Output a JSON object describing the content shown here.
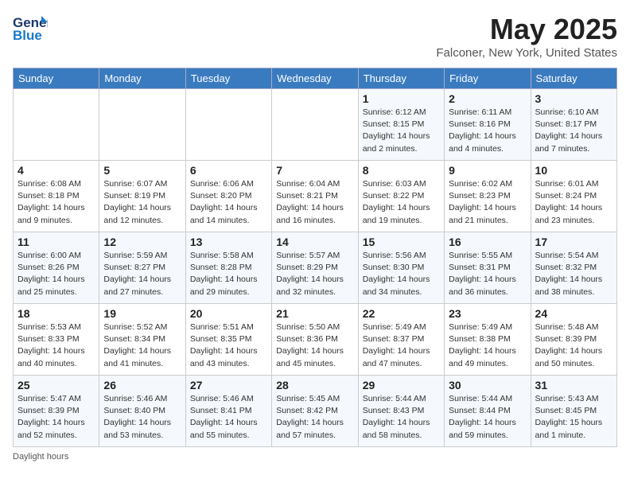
{
  "header": {
    "logo_line1": "General",
    "logo_line2": "Blue",
    "month": "May 2025",
    "location": "Falconer, New York, United States"
  },
  "days_of_week": [
    "Sunday",
    "Monday",
    "Tuesday",
    "Wednesday",
    "Thursday",
    "Friday",
    "Saturday"
  ],
  "weeks": [
    [
      {
        "day": "",
        "info": ""
      },
      {
        "day": "",
        "info": ""
      },
      {
        "day": "",
        "info": ""
      },
      {
        "day": "",
        "info": ""
      },
      {
        "day": "1",
        "info": "Sunrise: 6:12 AM\nSunset: 8:15 PM\nDaylight: 14 hours and 2 minutes."
      },
      {
        "day": "2",
        "info": "Sunrise: 6:11 AM\nSunset: 8:16 PM\nDaylight: 14 hours and 4 minutes."
      },
      {
        "day": "3",
        "info": "Sunrise: 6:10 AM\nSunset: 8:17 PM\nDaylight: 14 hours and 7 minutes."
      }
    ],
    [
      {
        "day": "4",
        "info": "Sunrise: 6:08 AM\nSunset: 8:18 PM\nDaylight: 14 hours and 9 minutes."
      },
      {
        "day": "5",
        "info": "Sunrise: 6:07 AM\nSunset: 8:19 PM\nDaylight: 14 hours and 12 minutes."
      },
      {
        "day": "6",
        "info": "Sunrise: 6:06 AM\nSunset: 8:20 PM\nDaylight: 14 hours and 14 minutes."
      },
      {
        "day": "7",
        "info": "Sunrise: 6:04 AM\nSunset: 8:21 PM\nDaylight: 14 hours and 16 minutes."
      },
      {
        "day": "8",
        "info": "Sunrise: 6:03 AM\nSunset: 8:22 PM\nDaylight: 14 hours and 19 minutes."
      },
      {
        "day": "9",
        "info": "Sunrise: 6:02 AM\nSunset: 8:23 PM\nDaylight: 14 hours and 21 minutes."
      },
      {
        "day": "10",
        "info": "Sunrise: 6:01 AM\nSunset: 8:24 PM\nDaylight: 14 hours and 23 minutes."
      }
    ],
    [
      {
        "day": "11",
        "info": "Sunrise: 6:00 AM\nSunset: 8:26 PM\nDaylight: 14 hours and 25 minutes."
      },
      {
        "day": "12",
        "info": "Sunrise: 5:59 AM\nSunset: 8:27 PM\nDaylight: 14 hours and 27 minutes."
      },
      {
        "day": "13",
        "info": "Sunrise: 5:58 AM\nSunset: 8:28 PM\nDaylight: 14 hours and 29 minutes."
      },
      {
        "day": "14",
        "info": "Sunrise: 5:57 AM\nSunset: 8:29 PM\nDaylight: 14 hours and 32 minutes."
      },
      {
        "day": "15",
        "info": "Sunrise: 5:56 AM\nSunset: 8:30 PM\nDaylight: 14 hours and 34 minutes."
      },
      {
        "day": "16",
        "info": "Sunrise: 5:55 AM\nSunset: 8:31 PM\nDaylight: 14 hours and 36 minutes."
      },
      {
        "day": "17",
        "info": "Sunrise: 5:54 AM\nSunset: 8:32 PM\nDaylight: 14 hours and 38 minutes."
      }
    ],
    [
      {
        "day": "18",
        "info": "Sunrise: 5:53 AM\nSunset: 8:33 PM\nDaylight: 14 hours and 40 minutes."
      },
      {
        "day": "19",
        "info": "Sunrise: 5:52 AM\nSunset: 8:34 PM\nDaylight: 14 hours and 41 minutes."
      },
      {
        "day": "20",
        "info": "Sunrise: 5:51 AM\nSunset: 8:35 PM\nDaylight: 14 hours and 43 minutes."
      },
      {
        "day": "21",
        "info": "Sunrise: 5:50 AM\nSunset: 8:36 PM\nDaylight: 14 hours and 45 minutes."
      },
      {
        "day": "22",
        "info": "Sunrise: 5:49 AM\nSunset: 8:37 PM\nDaylight: 14 hours and 47 minutes."
      },
      {
        "day": "23",
        "info": "Sunrise: 5:49 AM\nSunset: 8:38 PM\nDaylight: 14 hours and 49 minutes."
      },
      {
        "day": "24",
        "info": "Sunrise: 5:48 AM\nSunset: 8:39 PM\nDaylight: 14 hours and 50 minutes."
      }
    ],
    [
      {
        "day": "25",
        "info": "Sunrise: 5:47 AM\nSunset: 8:39 PM\nDaylight: 14 hours and 52 minutes."
      },
      {
        "day": "26",
        "info": "Sunrise: 5:46 AM\nSunset: 8:40 PM\nDaylight: 14 hours and 53 minutes."
      },
      {
        "day": "27",
        "info": "Sunrise: 5:46 AM\nSunset: 8:41 PM\nDaylight: 14 hours and 55 minutes."
      },
      {
        "day": "28",
        "info": "Sunrise: 5:45 AM\nSunset: 8:42 PM\nDaylight: 14 hours and 57 minutes."
      },
      {
        "day": "29",
        "info": "Sunrise: 5:44 AM\nSunset: 8:43 PM\nDaylight: 14 hours and 58 minutes."
      },
      {
        "day": "30",
        "info": "Sunrise: 5:44 AM\nSunset: 8:44 PM\nDaylight: 14 hours and 59 minutes."
      },
      {
        "day": "31",
        "info": "Sunrise: 5:43 AM\nSunset: 8:45 PM\nDaylight: 15 hours and 1 minute."
      }
    ]
  ],
  "footer": {
    "daylight_label": "Daylight hours"
  }
}
